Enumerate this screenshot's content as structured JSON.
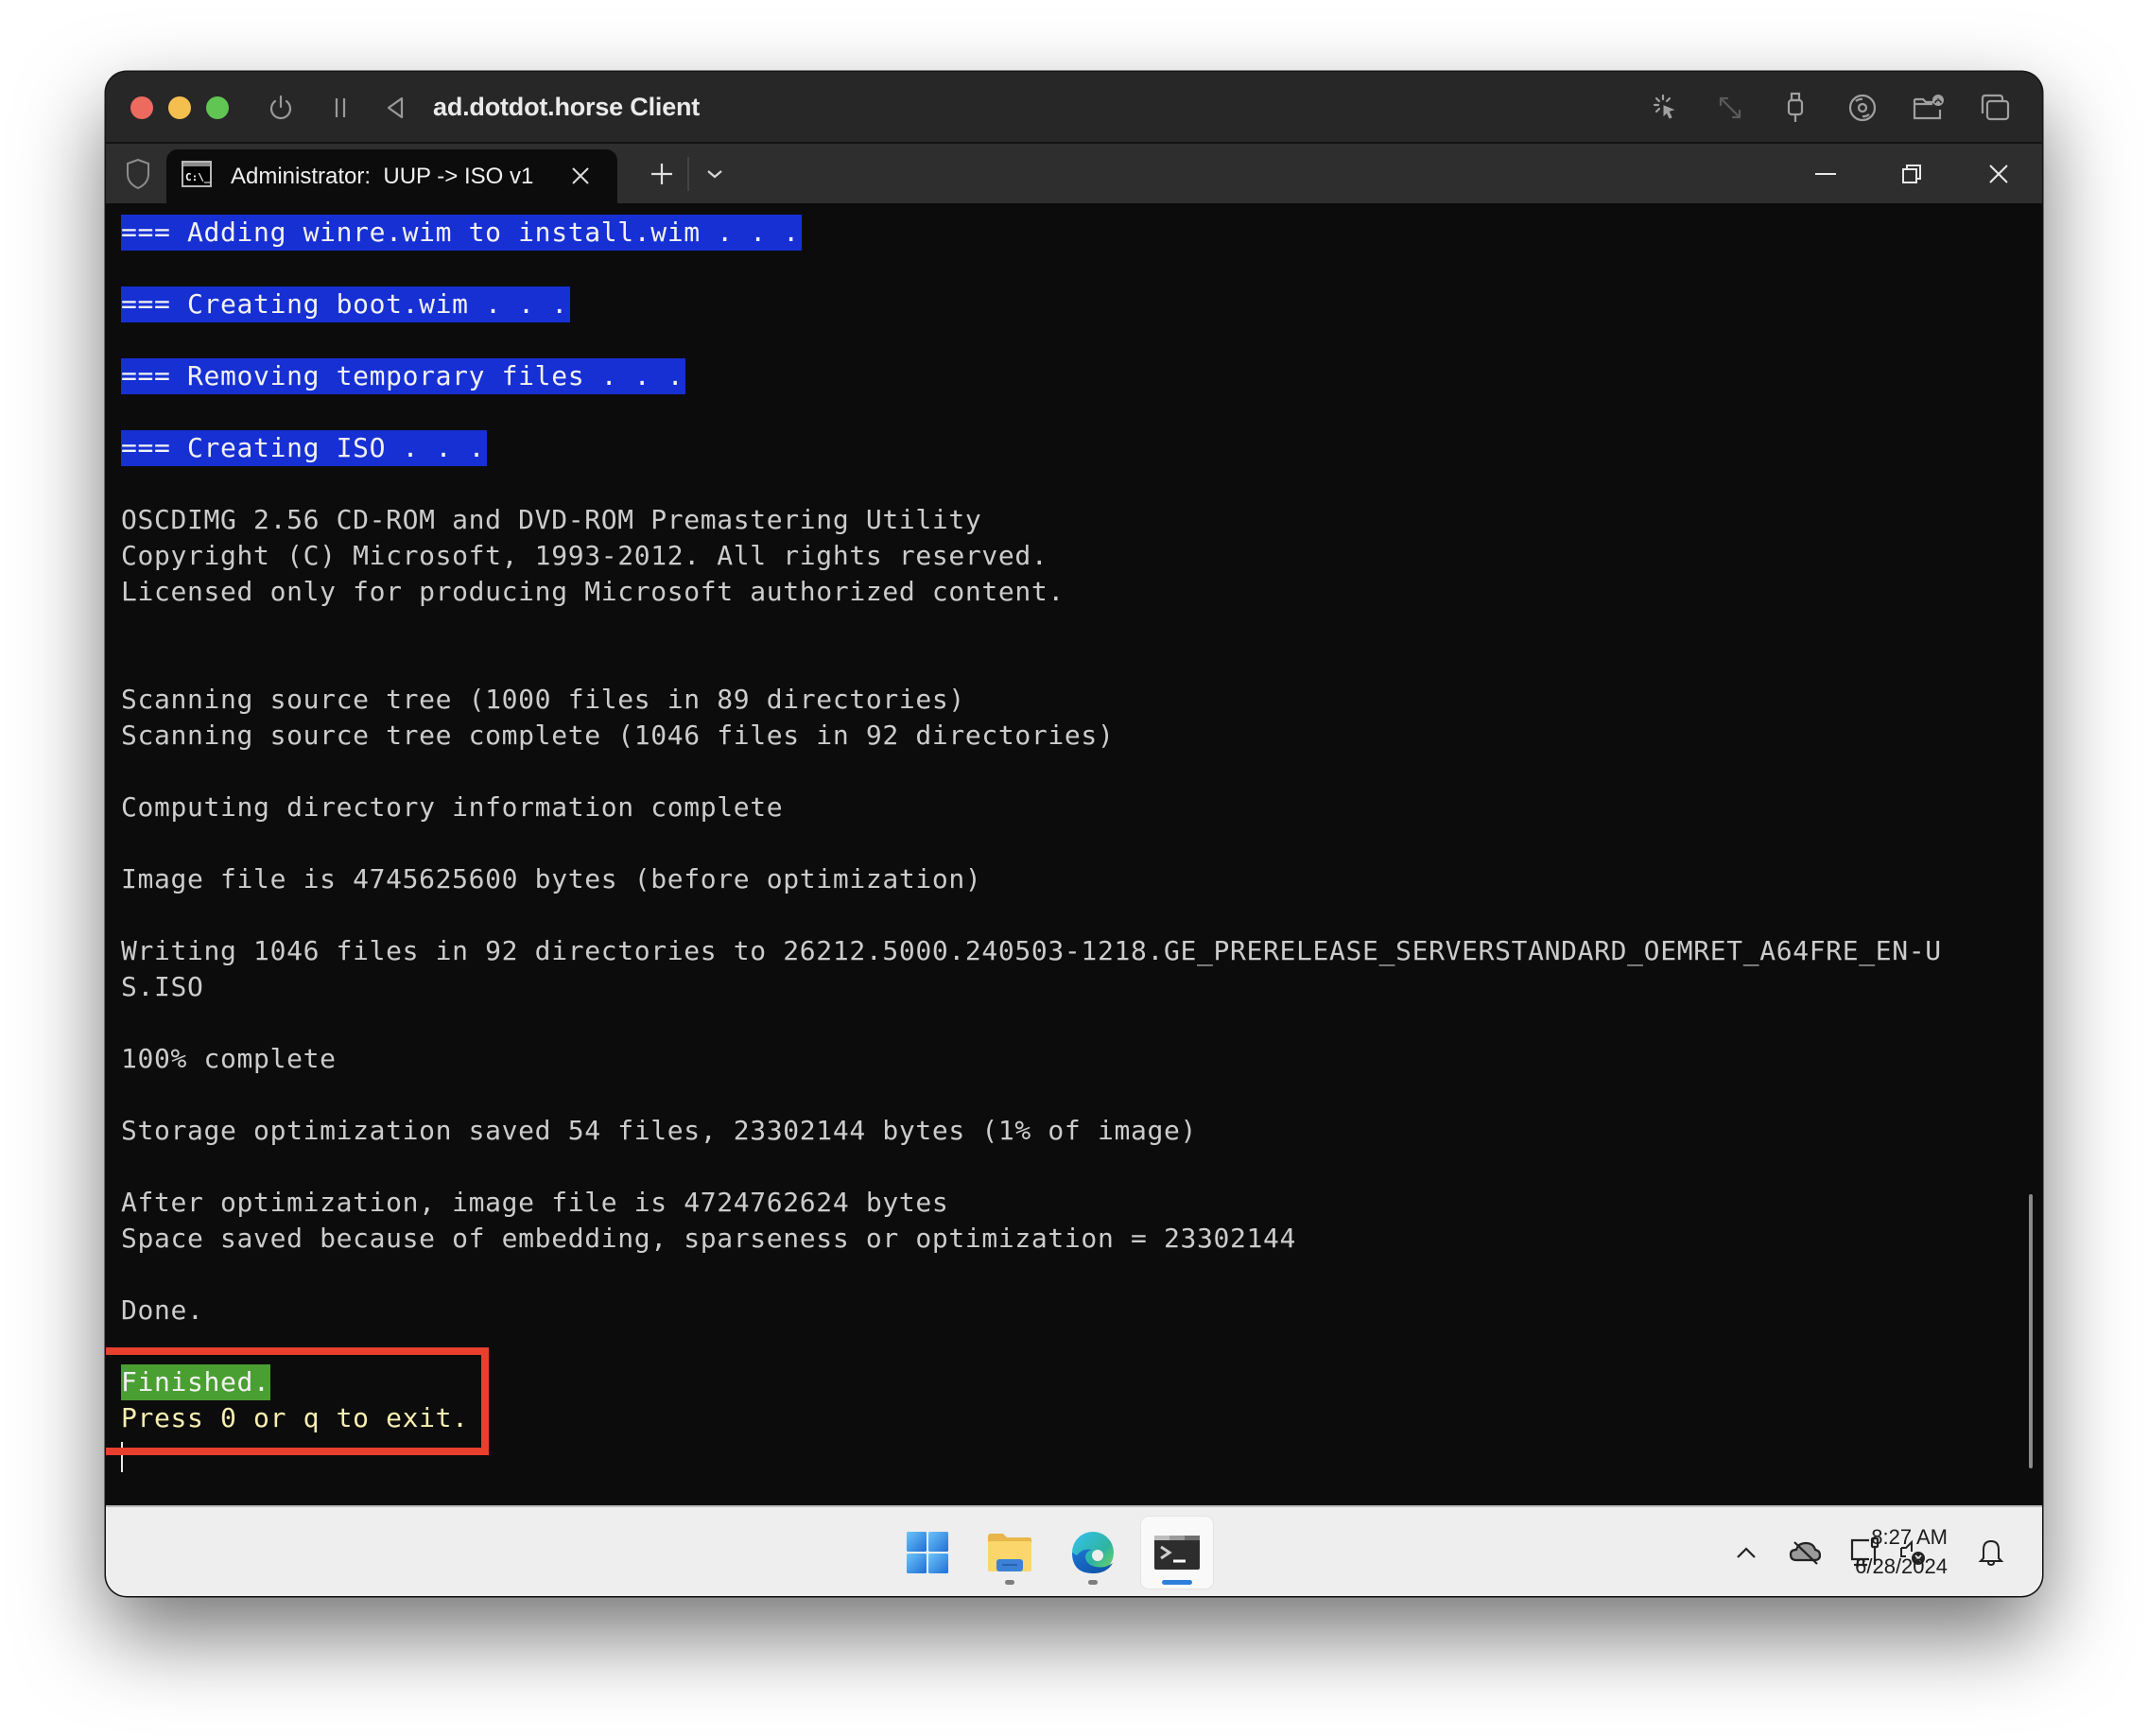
{
  "titlebar": {
    "app_title": "ad.dotdot.horse Client",
    "traffic_lights": {
      "close": "#ec6a5e",
      "minimize": "#f4bf4f",
      "zoom": "#61c554"
    },
    "left_icons": [
      "power-icon",
      "pause-icon",
      "back-triangle-icon"
    ],
    "right_icons": [
      "cursor-capture-icon",
      "resize-icon",
      "usb-icon",
      "disc-icon",
      "shared-folder-icon",
      "windows-icon"
    ]
  },
  "tabbar": {
    "tabs": [
      {
        "label": "Administrator:  UUP -> ISO v1",
        "icon": "cmd-icon",
        "active": true
      }
    ],
    "new_tab_icon": "plus-icon",
    "dropdown_icon": "chevron-down-icon",
    "window_controls": [
      "minimize-icon",
      "restore-icon",
      "close-icon"
    ]
  },
  "terminal": {
    "highlight_blue": "#1730d4",
    "highlight_green": "#4a9f32",
    "lines": [
      {
        "text": "=== Adding winre.wim to install.wim . . .",
        "style": "blue"
      },
      {
        "text": "",
        "style": "plain"
      },
      {
        "text": "=== Creating boot.wim . . .",
        "style": "blue"
      },
      {
        "text": "",
        "style": "plain"
      },
      {
        "text": "=== Removing temporary files . . .",
        "style": "blue"
      },
      {
        "text": "",
        "style": "plain"
      },
      {
        "text": "=== Creating ISO . . .",
        "style": "blue"
      },
      {
        "text": "",
        "style": "plain"
      },
      {
        "text": "OSCDIMG 2.56 CD-ROM and DVD-ROM Premastering Utility",
        "style": "plain"
      },
      {
        "text": "Copyright (C) Microsoft, 1993-2012. All rights reserved.",
        "style": "plain"
      },
      {
        "text": "Licensed only for producing Microsoft authorized content.",
        "style": "plain"
      },
      {
        "text": "",
        "style": "plain"
      },
      {
        "text": "",
        "style": "plain"
      },
      {
        "text": "Scanning source tree (1000 files in 89 directories)",
        "style": "plain"
      },
      {
        "text": "Scanning source tree complete (1046 files in 92 directories)",
        "style": "plain"
      },
      {
        "text": "",
        "style": "plain"
      },
      {
        "text": "Computing directory information complete",
        "style": "plain"
      },
      {
        "text": "",
        "style": "plain"
      },
      {
        "text": "Image file is 4745625600 bytes (before optimization)",
        "style": "plain"
      },
      {
        "text": "",
        "style": "plain"
      },
      {
        "text": "Writing 1046 files in 92 directories to 26212.5000.240503-1218.GE_PRERELEASE_SERVERSTANDARD_OEMRET_A64FRE_EN-U",
        "style": "plain"
      },
      {
        "text": "S.ISO",
        "style": "plain"
      },
      {
        "text": "",
        "style": "plain"
      },
      {
        "text": "100% complete",
        "style": "plain"
      },
      {
        "text": "",
        "style": "plain"
      },
      {
        "text": "Storage optimization saved 54 files, 23302144 bytes (1% of image)",
        "style": "plain"
      },
      {
        "text": "",
        "style": "plain"
      },
      {
        "text": "After optimization, image file is 4724762624 bytes",
        "style": "plain"
      },
      {
        "text": "Space saved because of embedding, sparseness or optimization = 23302144",
        "style": "plain"
      },
      {
        "text": "",
        "style": "plain"
      },
      {
        "text": "Done.",
        "style": "plain"
      },
      {
        "text": "",
        "style": "plain"
      },
      {
        "text": "Finished.",
        "style": "green"
      },
      {
        "text": "Press 0 or q to exit.",
        "style": "yellow"
      }
    ],
    "annotation_box_color": "#e8402c"
  },
  "taskbar": {
    "apps": [
      {
        "name": "start",
        "icon": "windows-start-icon",
        "running": false,
        "active": false
      },
      {
        "name": "file-explorer",
        "icon": "folder-icon",
        "running": true,
        "active": false
      },
      {
        "name": "edge",
        "icon": "edge-browser-icon",
        "running": true,
        "active": false
      },
      {
        "name": "terminal",
        "icon": "terminal-icon",
        "running": true,
        "active": true
      }
    ],
    "tray_icons": [
      "chevron-up-icon",
      "onedrive-off-icon",
      "network-wired-icon",
      "volume-muted-icon"
    ],
    "time": "8:27 AM",
    "date": "6/28/2024",
    "notification_icon": "bell-icon"
  }
}
